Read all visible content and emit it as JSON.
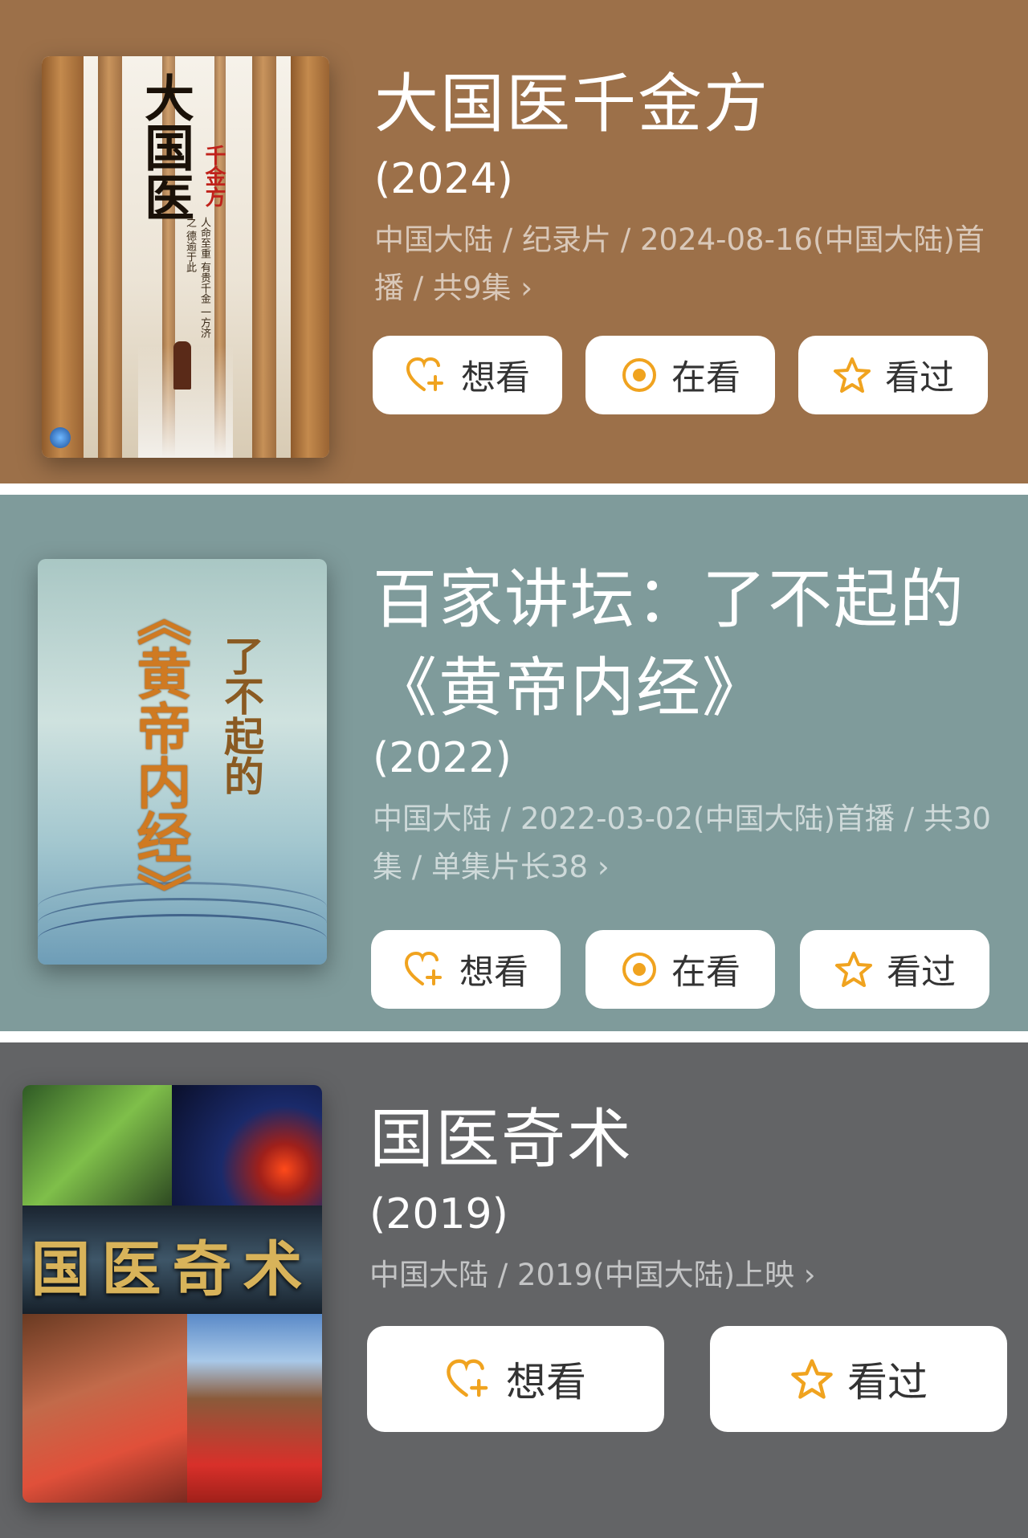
{
  "accent": "#f0a31f",
  "items": [
    {
      "title_lines": [
        "大国医千金方"
      ],
      "year": "(2024)",
      "meta": "中国大陆 / 纪录片 / 2024-08-16(中国大陆)首播 / 共9集 ›",
      "buttons": [
        "想看",
        "在看",
        "看过"
      ],
      "poster": {
        "title": "大国医",
        "subtitle": "千金方",
        "tagline": "人命至重 有贵千金 一方济之 德逾于此"
      },
      "bg": "#9c7049"
    },
    {
      "title_lines": [
        "百家讲坛：了不起的",
        "《黄帝内经》"
      ],
      "year": "(2022)",
      "meta": "中国大陆 / 2022-03-02(中国大陆)首播 / 共30集 / 单集片长38 ›",
      "buttons": [
        "想看",
        "在看",
        "看过"
      ],
      "poster": {
        "title": "《黄帝内经》",
        "subtitle": "了不起的"
      },
      "bg": "#7f9b9b"
    },
    {
      "title_lines": [
        "国医奇术"
      ],
      "year": "(2019)",
      "meta": "中国大陆 / 2019(中国大陆)上映 ›",
      "buttons": [
        "想看",
        "看过"
      ],
      "poster": {
        "title": "国医奇术"
      },
      "bg": "#636466"
    }
  ]
}
